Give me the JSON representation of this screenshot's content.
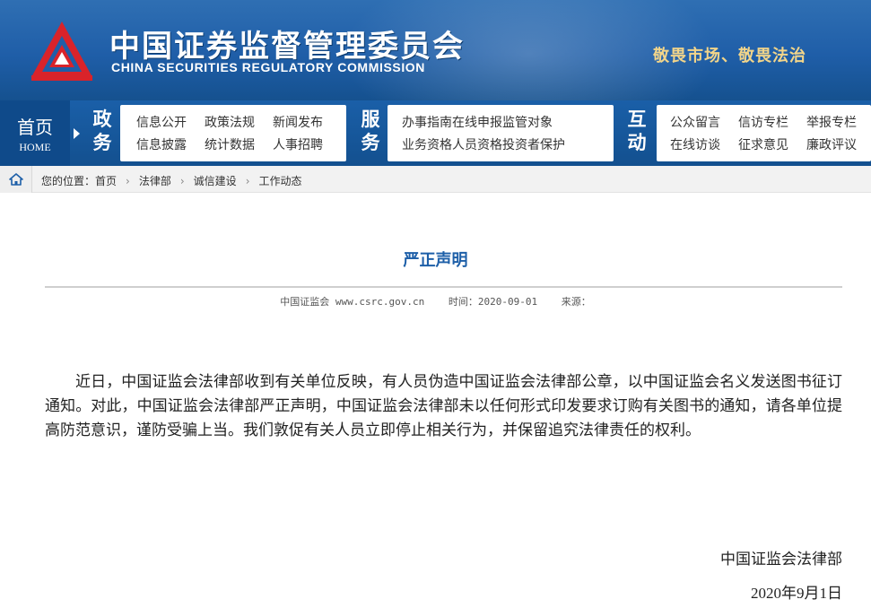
{
  "header": {
    "title_cn": "中国证券监督管理委员会",
    "title_en": "CHINA SECURITIES REGULATORY COMMISSION",
    "slogan": "敬畏市场、敬畏法治",
    "logo_icon": "csrc-logo-icon",
    "colors": {
      "banner": "#1f5ea8",
      "logo_red": "#d9232a",
      "slogan": "#f2d58a"
    }
  },
  "nav": {
    "home_cn": "首页",
    "home_en": "HOME",
    "groups": [
      {
        "label": "政务",
        "items": [
          "信息公开",
          "政策法规",
          "新闻发布",
          "信息披露",
          "统计数据",
          "人事招聘"
        ]
      },
      {
        "label": "服务",
        "items": [
          "办事指南",
          "在线申报",
          "监管对象",
          "业务资格",
          "人员资格",
          "投资者保护"
        ]
      },
      {
        "label": "互动",
        "items": [
          "公众留言",
          "信访专栏",
          "举报专栏",
          "在线访谈",
          "征求意见",
          "廉政评议"
        ]
      }
    ]
  },
  "breadcrumb": {
    "prefix": "您的位置：",
    "items": [
      "首页",
      "法律部",
      "诚信建设",
      "工作动态"
    ],
    "separator": "›",
    "home_icon": "home-icon"
  },
  "article": {
    "title": "严正声明",
    "meta": {
      "source": "中国证监会 www.csrc.gov.cn",
      "time": "时间：2020-09-01",
      "origin": "来源："
    },
    "body": "近日，中国证监会法律部收到有关单位反映，有人员伪造中国证监会法律部公章，以中国证监会名义发送图书征订通知。对此，中国证监会法律部严正声明，中国证监会法律部未以任何形式印发要求订购有关图书的通知，请各单位提高防范意识，谨防受骗上当。我们敦促有关人员立即停止相关行为，并保留追究法律责任的权利。",
    "signature": "中国证监会法律部",
    "date": "2020年9月1日"
  }
}
